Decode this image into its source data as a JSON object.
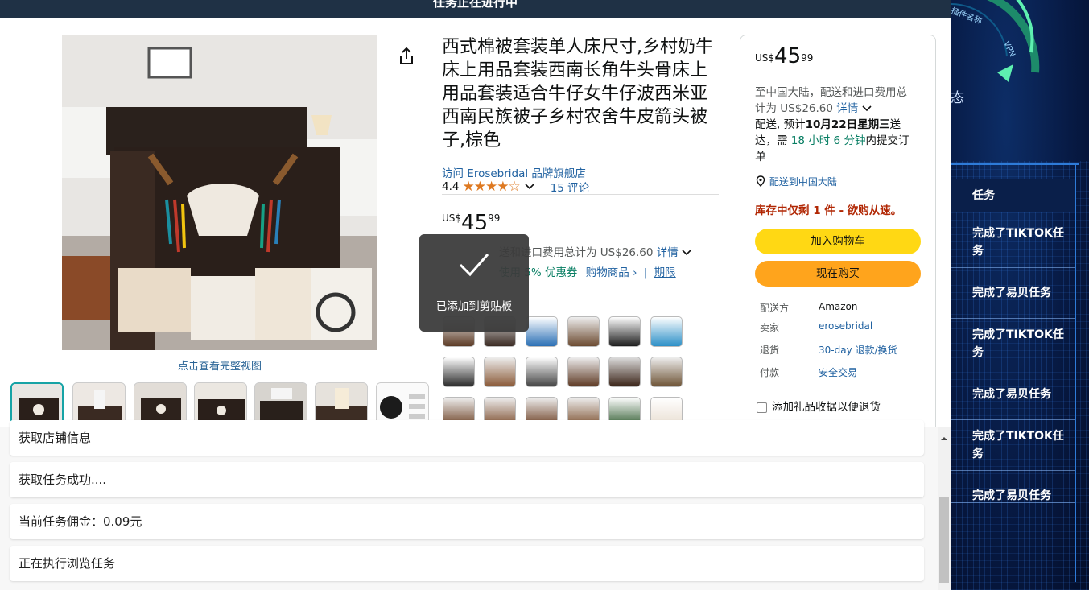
{
  "topbar": {
    "title": "任务正在进行中"
  },
  "gallery": {
    "view_full_label": "点击查看完整视图",
    "thumbnails": [
      "thumb-1",
      "thumb-2",
      "thumb-3",
      "thumb-4",
      "thumb-5",
      "thumb-6",
      "thumb-7"
    ]
  },
  "product": {
    "title": "西式棉被套装单人床尺寸,乡村奶牛床上用品套装西南长角牛头骨床上用品套装适合牛仔女牛仔波西米亚西南民族被子乡村农舍牛皮箭头被子,棕色",
    "store_link": "访问 Erosebridal 品牌旗舰店",
    "rating": "4.4",
    "stars": "★★★★☆",
    "reviews": "15 评论",
    "price_currency": "US$",
    "price_whole": "45",
    "price_cents": "99",
    "ship_fee_text": "送和进口费用总计为 US$26.60",
    "ship_details_link": "详情",
    "coupon_text": "使用 5% 优惠券",
    "coupon_shop_link": "购物商品 ›",
    "coupon_sep": "|",
    "coupon_terms_link": "期限"
  },
  "toast": {
    "message": "已添加到剪贴板"
  },
  "buybox": {
    "price_currency": "US$",
    "price_whole": "45",
    "price_cents": "99",
    "ship_line1": "至中国大陆，配送和进口费用总",
    "ship_line2_prefix": "计为 US$26.60",
    "details_link": "详情",
    "delivery_prefix": "配送, 预计",
    "delivery_date": "10月22日星期三",
    "delivery_suffix": "送",
    "delivery_line2_prefix": "达，需 ",
    "countdown": "18 小时 6 分钟",
    "delivery_line2_suffix": "内提交订",
    "delivery_line3": "单",
    "location": "配送到中国大陆",
    "stock": "库存中仅剩 1 件 - 欲购从速。",
    "add_to_cart": "加入购物车",
    "buy_now": "现在购买",
    "ships_from_label": "配送方",
    "ships_from_value": "Amazon",
    "seller_label": "卖家",
    "seller_value": "erosebridal",
    "returns_label": "退货",
    "returns_value": "30-day 退款/换货",
    "payment_label": "付款",
    "payment_value": "安全交易",
    "gift_receipt": "添加礼品收据以便退货"
  },
  "log": {
    "items": [
      "获取店铺信息",
      "获取任务成功....",
      "当前任务佣金：0.09元",
      "正在执行浏览任务"
    ]
  },
  "right_panel": {
    "gauge_text": "插件名称",
    "gauge_vpn": "VPN",
    "status_fragment": "态",
    "tasks_header": "任务",
    "tasks": [
      "完成了TIKTOK任务",
      "完成了易贝任务",
      "完成了TIKTOK任务",
      "完成了易贝任务",
      "完成了TIKTOK任务",
      "完成了易贝任务"
    ]
  },
  "colors": {
    "topbar": "#1f3145",
    "add_to_cart": "#ffd814",
    "buy_now": "#ffa41c",
    "stock_red": "#b12704",
    "link_blue": "#2162a1",
    "countdown_green": "#067d62",
    "thumb_selected": "#16a3a6"
  }
}
